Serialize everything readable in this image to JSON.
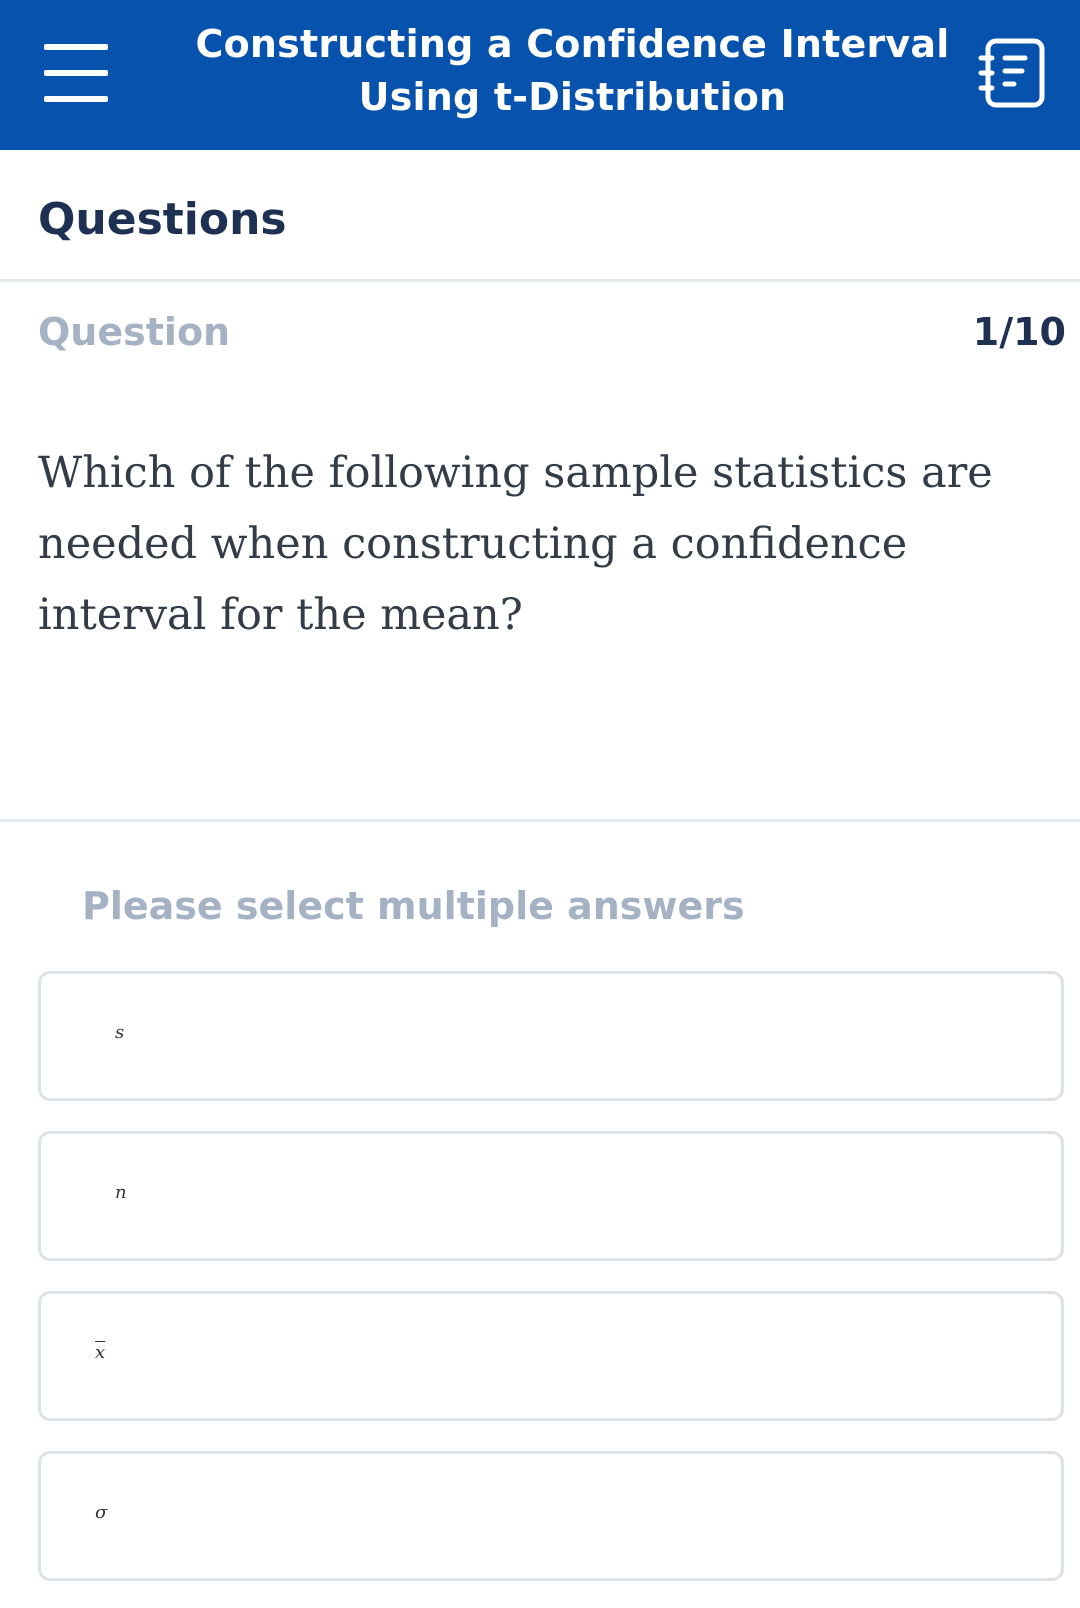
{
  "header": {
    "title": "Constructing a Confidence Interval Using t-Distribution",
    "menu_icon": "hamburger-menu-icon",
    "notes_icon": "notebook-icon",
    "background_color": "#0652ad"
  },
  "section": {
    "title": "Questions"
  },
  "question": {
    "label": "Question",
    "counter": "1/10",
    "text": "Which of the following sample statistics are needed when constructing a confidence interval for the mean?"
  },
  "answers": {
    "instruction": "Please select multiple answers",
    "options": [
      {
        "label": "s"
      },
      {
        "label": "n"
      },
      {
        "label": "x"
      },
      {
        "label": "σ"
      }
    ]
  }
}
